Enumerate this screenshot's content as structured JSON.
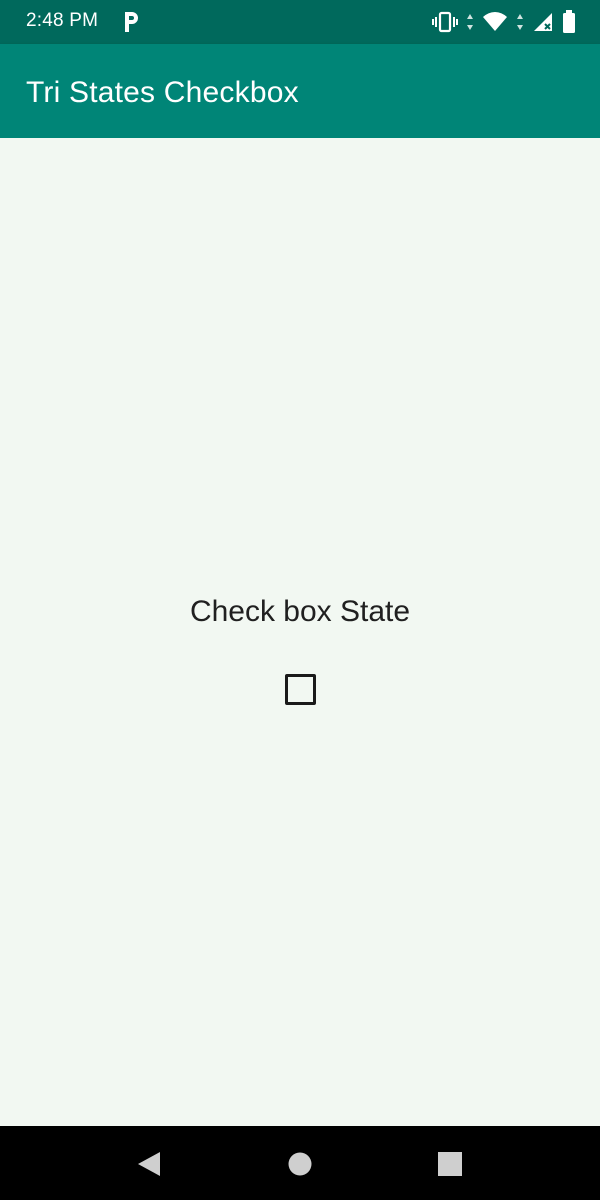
{
  "status_bar": {
    "time": "2:48 PM",
    "icons": [
      "p-notification-icon",
      "vibrate-icon",
      "wifi-icon",
      "signal-icon",
      "battery-icon"
    ]
  },
  "app_bar": {
    "title": "Tri States Checkbox"
  },
  "main": {
    "state_label": "Check box State",
    "checkbox_state": "unchecked"
  },
  "nav_bar": {
    "buttons": [
      "back",
      "home",
      "recents"
    ]
  },
  "colors": {
    "status_bar": "#00695c",
    "app_bar": "#008577",
    "background": "#f2f8f2",
    "nav_bar": "#000000"
  }
}
